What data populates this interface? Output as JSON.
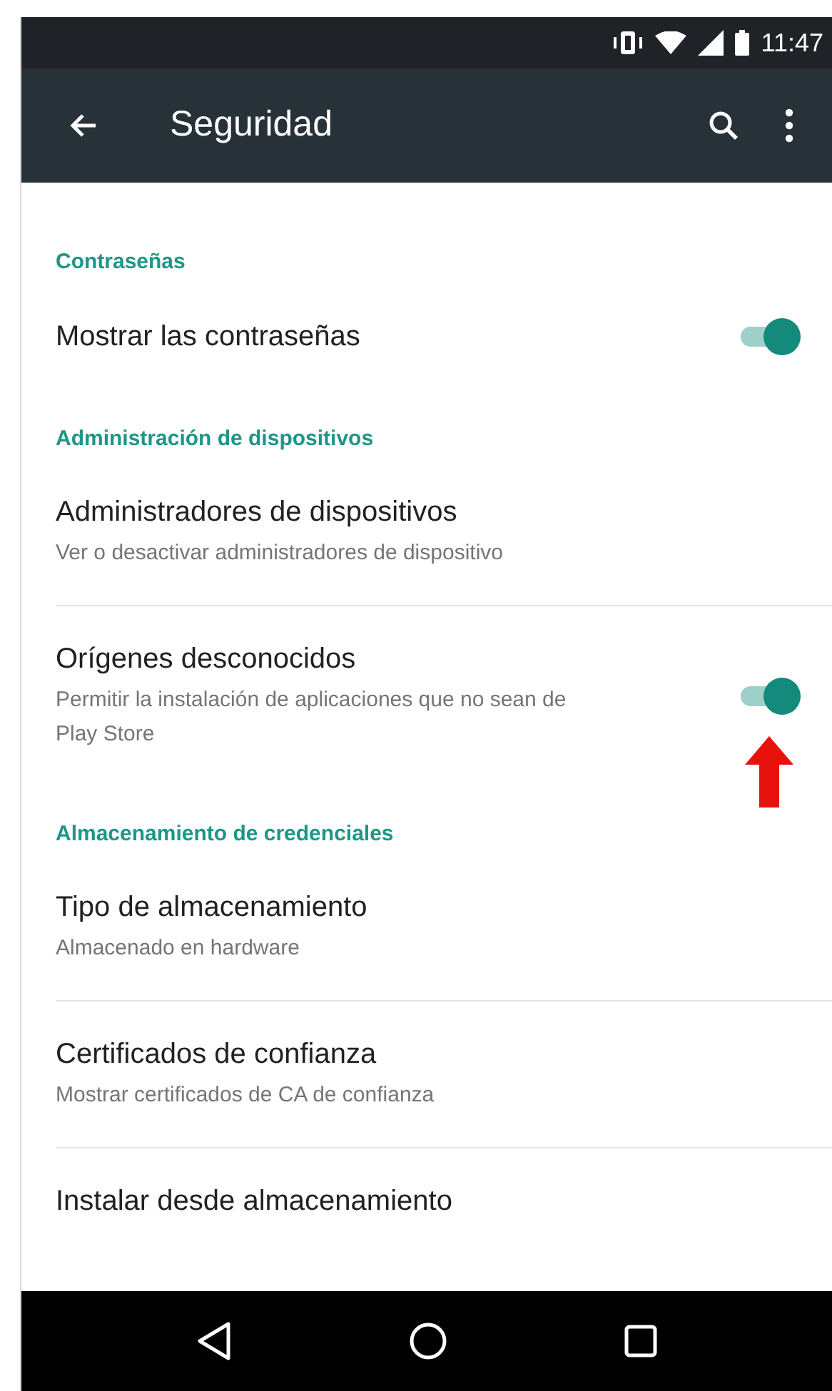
{
  "status_bar": {
    "time": "11:47"
  },
  "app_bar": {
    "title": "Seguridad"
  },
  "items": [
    {
      "kind": "header",
      "title": "Contraseñas"
    },
    {
      "kind": "toggle",
      "title": "Mostrar las contraseñas",
      "on": true,
      "divider": false
    },
    {
      "kind": "header",
      "title": "Administración de dispositivos"
    },
    {
      "kind": "text",
      "title": "Administradores de dispositivos",
      "subtitle": "Ver o desactivar administradores de dispositivo",
      "divider": true
    },
    {
      "kind": "toggle",
      "title": "Orígenes desconocidos",
      "subtitle": "Permitir la instalación de aplicaciones que no sean de Play Store",
      "on": true,
      "divider": false,
      "arrow": true
    },
    {
      "kind": "header",
      "title": "Almacenamiento de credenciales"
    },
    {
      "kind": "text",
      "title": "Tipo de almacenamiento",
      "subtitle": "Almacenado en hardware",
      "divider": true
    },
    {
      "kind": "text",
      "title": "Certificados de confianza",
      "subtitle": "Mostrar certificados de CA de confianza",
      "divider": true
    },
    {
      "kind": "text",
      "title": "Instalar desde almacenamiento",
      "divider": false
    }
  ]
}
